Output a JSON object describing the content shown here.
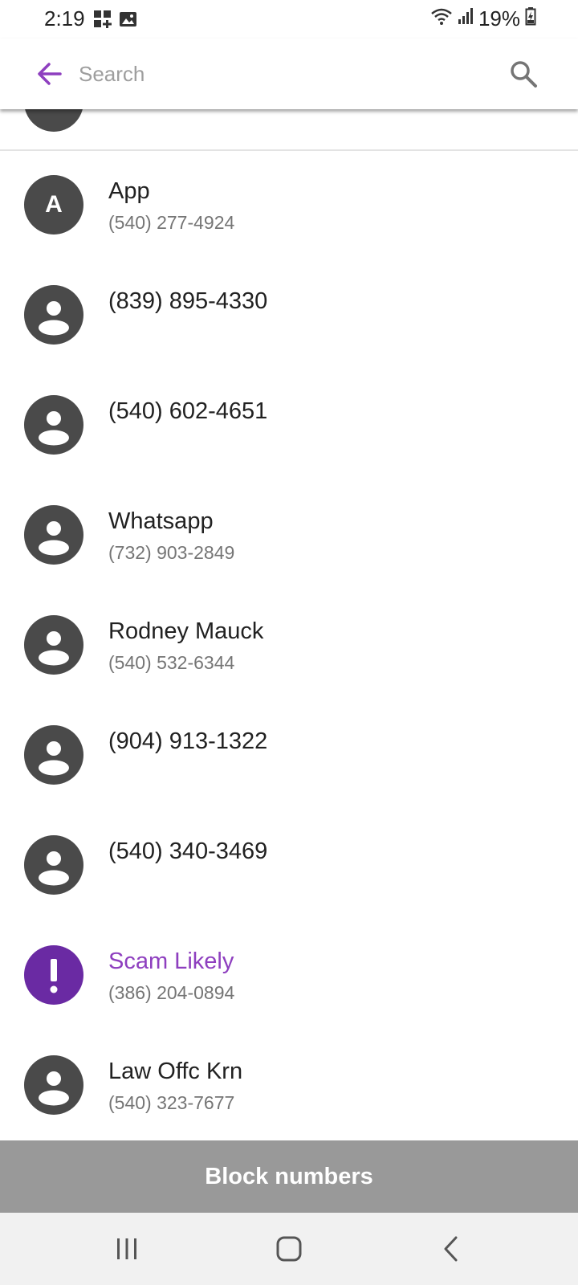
{
  "status_bar": {
    "time": "2:19",
    "battery": "19%"
  },
  "toolbar": {
    "search_placeholder": "Search"
  },
  "contacts": [
    {
      "name": "App",
      "number": "(540) 277-4924",
      "avatar": "letter",
      "letter": "A",
      "type": "normal"
    },
    {
      "name": "(839) 895-4330",
      "number": "",
      "avatar": "person-icon",
      "type": "normal"
    },
    {
      "name": "(540) 602-4651",
      "number": "",
      "avatar": "person-icon",
      "type": "normal"
    },
    {
      "name": "Whatsapp",
      "number": "(732) 903-2849",
      "avatar": "person-icon",
      "type": "normal"
    },
    {
      "name": "Rodney Mauck",
      "number": "(540) 532-6344",
      "avatar": "person-icon",
      "type": "normal"
    },
    {
      "name": "(904) 913-1322",
      "number": "",
      "avatar": "person-icon",
      "type": "normal"
    },
    {
      "name": "(540) 340-3469",
      "number": "",
      "avatar": "person-icon",
      "type": "normal"
    },
    {
      "name": "Scam Likely",
      "number": "(386) 204-0894",
      "avatar": "exclamation-icon",
      "type": "scam"
    },
    {
      "name": "Law Offc Krn",
      "number": "(540) 323-7677",
      "avatar": "person-icon",
      "type": "normal"
    }
  ],
  "block_button": {
    "label": "Block numbers"
  },
  "colors": {
    "accent": "#8e3fbf",
    "scam_avatar": "#6a2aa3",
    "avatar": "#4a4a4a",
    "block_button": "#999999"
  }
}
